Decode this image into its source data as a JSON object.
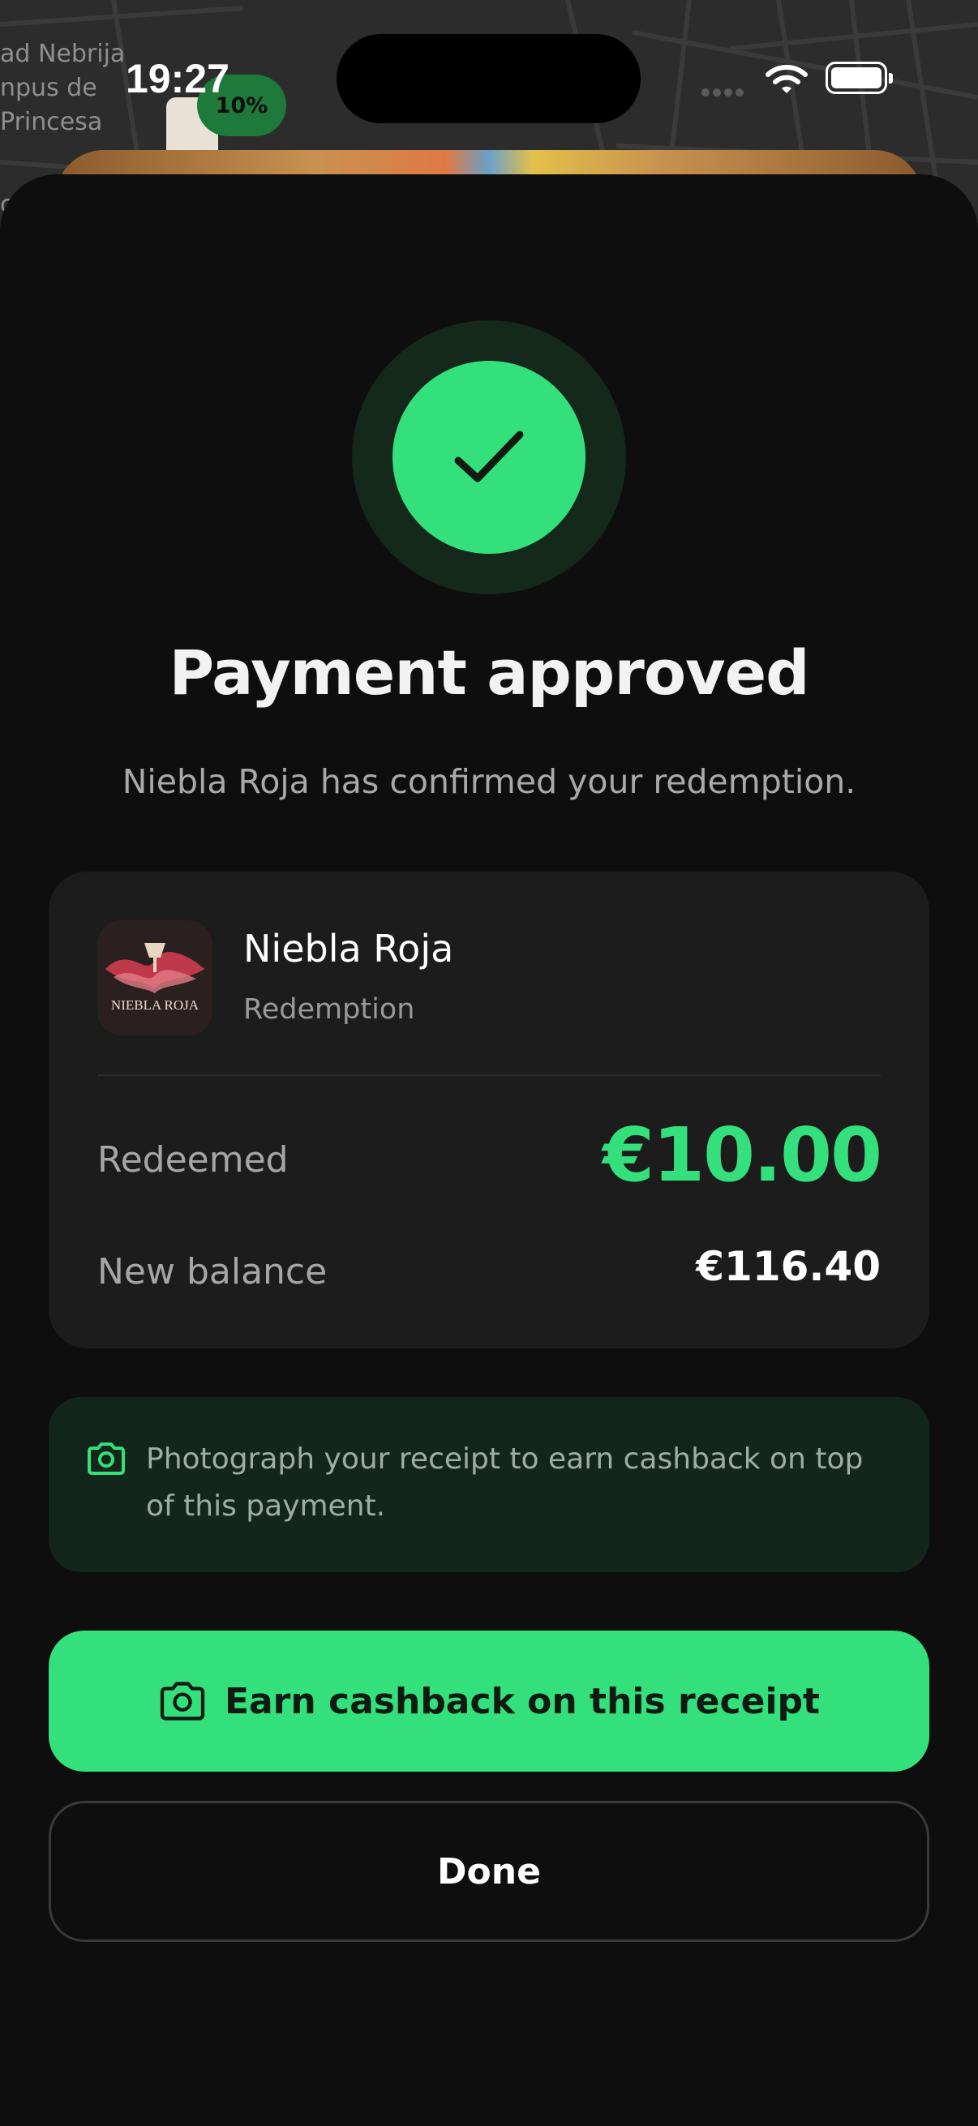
{
  "status_bar": {
    "time": "19:27"
  },
  "map": {
    "labels": [
      "ad Nebrija",
      "npus de",
      "Princesa",
      "cio"
    ],
    "badge": "10%"
  },
  "header": {
    "title": "Payment approved",
    "subtitle": "Niebla Roja has confirmed your redemption."
  },
  "merchant": {
    "name": "Niebla Roja",
    "type": "Redemption",
    "logo_text": "NIEBLA ROJA"
  },
  "summary": {
    "redeemed_label": "Redeemed",
    "redeemed_value": "€10.00",
    "balance_label": "New balance",
    "balance_value": "€116.40"
  },
  "info": {
    "icon": "camera-icon",
    "text": "Photograph your receipt to earn cashback on top of this payment."
  },
  "actions": {
    "primary_label": "Earn cashback on this receipt",
    "primary_icon": "camera-icon",
    "done_label": "Done"
  },
  "colors": {
    "accent": "#34e07b",
    "sheet_bg": "#0e0e0e",
    "card_bg": "#1b1c1b",
    "info_bg": "#13261b"
  }
}
